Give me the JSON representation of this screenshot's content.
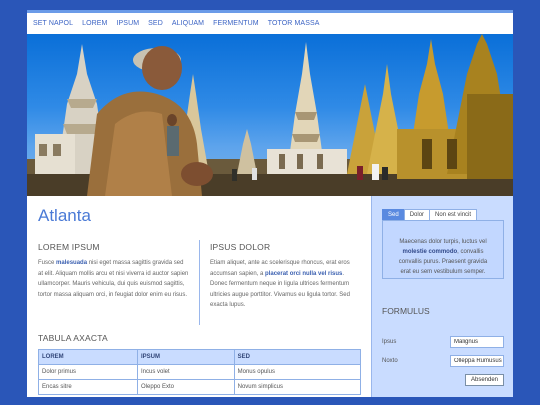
{
  "nav": [
    "SET NAPOL",
    "LOREM",
    "IPSUM",
    "SED",
    "ALIQUAM",
    "FERMENTUM",
    "TOTOR MASSA"
  ],
  "main": {
    "title": "Atlanta",
    "col1": {
      "heading": "LOREM IPSUM",
      "p_before": "Fusce ",
      "p_bold": "malesuada",
      "p_after": " nisi eget massa sagittis gravida sed at elit. Aliquam mollis arcu et nisi viverra id auctor sapien ullamcorper. Mauris vehicula, dui quis euismod sagittis, tortor massa aliquam orci, in feugiat dolor enim eu risus."
    },
    "col2": {
      "heading": "IPSUS DOLOR",
      "p_before": "Etiam aliquet, ante ac scelerisque rhoncus, erat eros accumsan sapien, a ",
      "p_bold": "placerat orci nulla vel risus",
      "p_after": ". Donec fermentum neque in ligula ultrices fermentum ultricies augue porttitor. Vivamus eu ligula tortor. Sed exacta lupus."
    },
    "table": {
      "heading": "TABULA AXACTA",
      "headers": [
        "LOREM",
        "IPSUM",
        "SED"
      ],
      "rows": [
        [
          "Dolor primus",
          "Incus volet",
          "Monus opulus"
        ],
        [
          "Encas sitre",
          "Oleppo Exto",
          "Novum simplicus"
        ]
      ]
    }
  },
  "side": {
    "tabs": [
      "Sed",
      "Dolor",
      "Non est vincit"
    ],
    "panel": {
      "line1": "Maecenas dolor turpis, luctus vel",
      "bold": "molestie commodo",
      "line2_after": ", convallis",
      "line3": "convallis purus. Praesent gravida",
      "line4": "erat eu sem vestibulum semper."
    },
    "form": {
      "title": "FORMULUS",
      "label1": "Ipsus",
      "value1": "Malignus",
      "label2": "Noxto",
      "value2": "Olleppa Rumusus",
      "button": "Absenden"
    }
  }
}
